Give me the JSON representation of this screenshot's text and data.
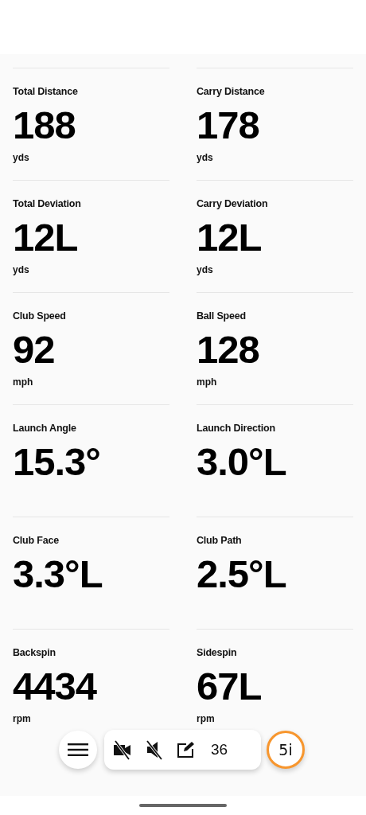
{
  "metrics": [
    {
      "label": "Total Distance",
      "value": "188",
      "unit": "yds"
    },
    {
      "label": "Carry Distance",
      "value": "178",
      "unit": "yds"
    },
    {
      "label": "Total Deviation",
      "value": "12L",
      "unit": "yds"
    },
    {
      "label": "Carry Deviation",
      "value": "12L",
      "unit": "yds"
    },
    {
      "label": "Club Speed",
      "value": "92",
      "unit": "mph"
    },
    {
      "label": "Ball Speed",
      "value": "128",
      "unit": "mph"
    },
    {
      "label": "Launch Angle",
      "value": "15.3°"
    },
    {
      "label": "Launch Direction",
      "value": "3.0°L"
    },
    {
      "label": "Club Face",
      "value": "3.3°L"
    },
    {
      "label": "Club Path",
      "value": "2.5°L"
    },
    {
      "label": "Backspin",
      "value": "4434",
      "unit": "rpm"
    },
    {
      "label": "Sidespin",
      "value": "67L",
      "unit": "rpm"
    }
  ],
  "toolbar": {
    "shot_count": "36",
    "club": "5i"
  }
}
